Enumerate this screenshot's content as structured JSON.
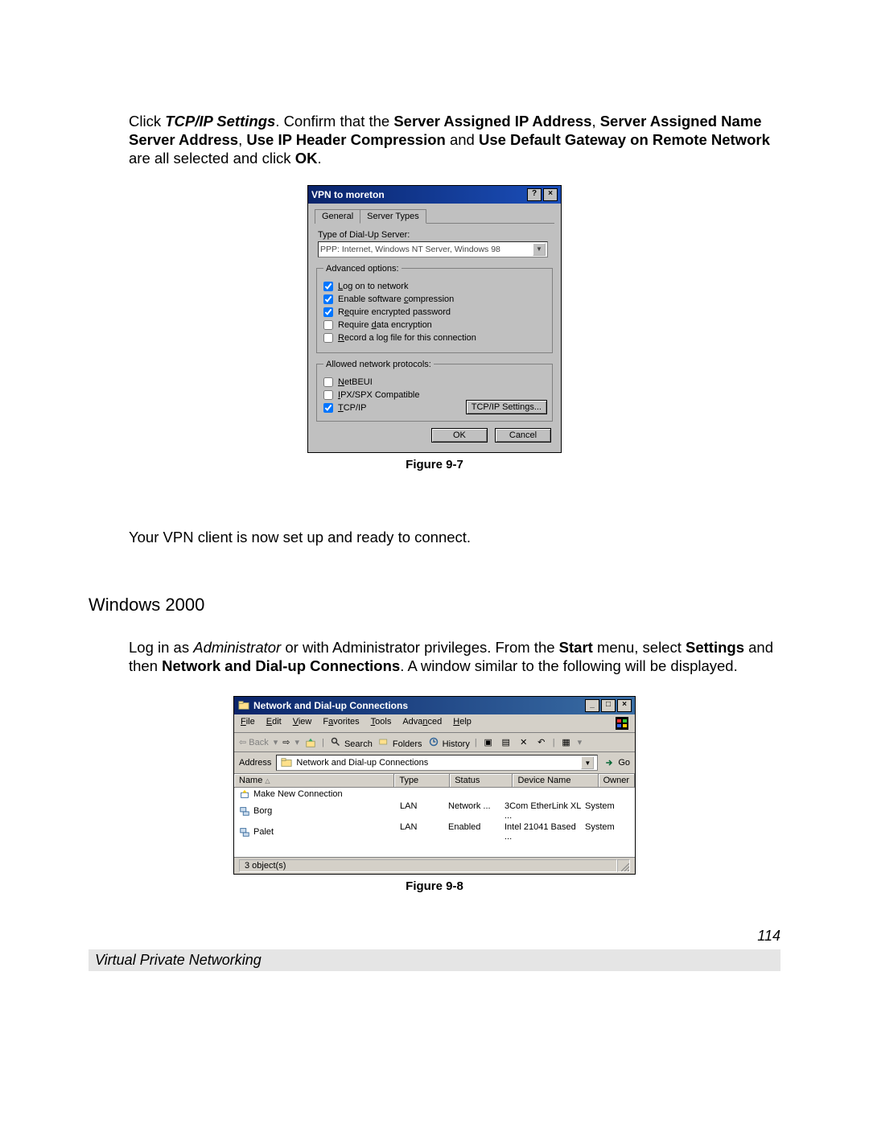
{
  "para1": {
    "p": [
      {
        "t": "Click ",
        "b": false,
        "i": false
      },
      {
        "t": "TCP/IP Settings",
        "b": true,
        "i": true
      },
      {
        "t": ".  Confirm that the ",
        "b": false,
        "i": false
      },
      {
        "t": "Server Assigned IP Address",
        "b": true,
        "i": false
      },
      {
        "t": ", ",
        "b": false,
        "i": false
      },
      {
        "t": "Server Assigned Name Server Address",
        "b": true,
        "i": false
      },
      {
        "t": ", ",
        "b": false,
        "i": false
      },
      {
        "t": "Use IP Header Compression",
        "b": true,
        "i": false
      },
      {
        "t": " and ",
        "b": false,
        "i": false
      },
      {
        "t": "Use Default Gateway on Remote Network",
        "b": true,
        "i": false
      },
      {
        "t": " are all selected and click ",
        "b": false,
        "i": false
      },
      {
        "t": "OK",
        "b": true,
        "i": false
      },
      {
        "t": ".",
        "b": false,
        "i": false
      }
    ]
  },
  "dialog1": {
    "title": "VPN to moreton",
    "tabs": [
      "General",
      "Server Types"
    ],
    "activeTab": 1,
    "serverTypeLabel": "Type of Dial-Up Server:",
    "serverTypeValue": "PPP: Internet, Windows NT Server, Windows 98",
    "advanced": {
      "legend": "Advanced options:",
      "items": [
        {
          "label": "Log on to network",
          "checked": true,
          "u": "L"
        },
        {
          "label": "Enable software compression",
          "checked": true,
          "u": "c"
        },
        {
          "label": "Require encrypted password",
          "checked": true,
          "u": "e"
        },
        {
          "label": "Require data encryption",
          "checked": false,
          "u": "d"
        },
        {
          "label": "Record a log file for this connection",
          "checked": false,
          "u": "R"
        }
      ]
    },
    "protocols": {
      "legend": "Allowed network protocols:",
      "items": [
        {
          "label": "NetBEUI",
          "checked": false,
          "u": "N"
        },
        {
          "label": "IPX/SPX Compatible",
          "checked": false,
          "u": "I"
        },
        {
          "label": "TCP/IP",
          "checked": true,
          "u": "T"
        }
      ],
      "button": "TCP/IP Settings..."
    },
    "ok": "OK",
    "cancel": "Cancel"
  },
  "caption1": "Figure 9-7",
  "midline": "Your VPN client is now set up and ready to connect.",
  "section": "Windows 2000",
  "para2": {
    "p": [
      {
        "t": "Log in as ",
        "b": false,
        "i": false
      },
      {
        "t": "Administrator",
        "b": false,
        "i": true
      },
      {
        "t": " or with Administrator privileges.  From the ",
        "b": false,
        "i": false
      },
      {
        "t": "Start",
        "b": true,
        "i": false
      },
      {
        "t": " menu, select ",
        "b": false,
        "i": false
      },
      {
        "t": "Settings",
        "b": true,
        "i": false
      },
      {
        "t": " and then ",
        "b": false,
        "i": false
      },
      {
        "t": "Network and Dial-up Connections",
        "b": true,
        "i": false
      },
      {
        "t": ".  A window similar to the following will be displayed.",
        "b": false,
        "i": false
      }
    ]
  },
  "explorer": {
    "title": "Network and Dial-up Connections",
    "menus": [
      "File",
      "Edit",
      "View",
      "Favorites",
      "Tools",
      "Advanced",
      "Help"
    ],
    "back": "Back",
    "search": "Search",
    "folders": "Folders",
    "history": "History",
    "addressLabel": "Address",
    "addressValue": "Network and Dial-up Connections",
    "go": "Go",
    "columns": [
      "Name",
      "Type",
      "Status",
      "Device Name",
      "Owner"
    ],
    "rows": [
      {
        "name": "Make New Connection",
        "type": "",
        "status": "",
        "device": "",
        "owner": ""
      },
      {
        "name": "Borg",
        "type": "LAN",
        "status": "Network ...",
        "device": "3Com EtherLink XL ...",
        "owner": "System"
      },
      {
        "name": "Palet",
        "type": "LAN",
        "status": "Enabled",
        "device": "Intel 21041 Based ...",
        "owner": "System"
      }
    ],
    "status": "3 object(s)"
  },
  "caption2": "Figure 9-8",
  "pageNumber": "114",
  "footer": "Virtual Private Networking"
}
